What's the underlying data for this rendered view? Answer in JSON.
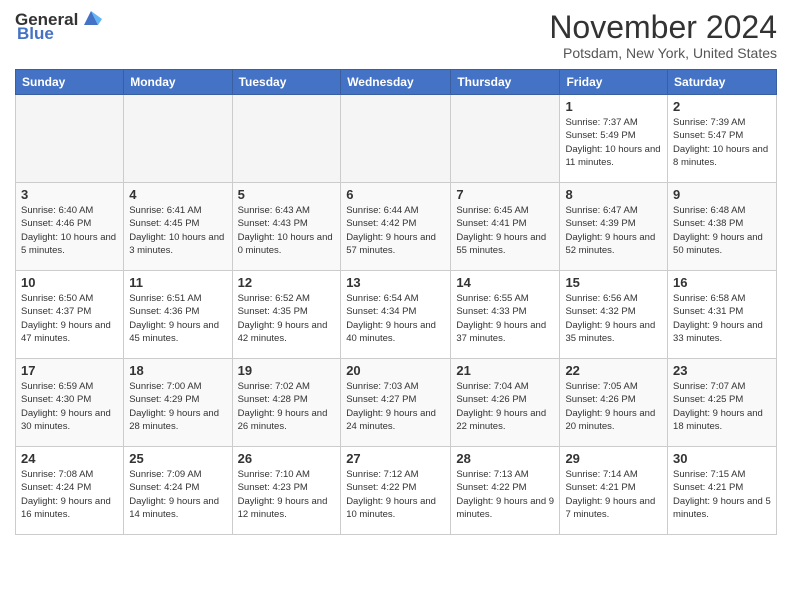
{
  "header": {
    "logo_general": "General",
    "logo_blue": "Blue",
    "month_title": "November 2024",
    "location": "Potsdam, New York, United States"
  },
  "days_of_week": [
    "Sunday",
    "Monday",
    "Tuesday",
    "Wednesday",
    "Thursday",
    "Friday",
    "Saturday"
  ],
  "weeks": [
    [
      {
        "day": "",
        "info": ""
      },
      {
        "day": "",
        "info": ""
      },
      {
        "day": "",
        "info": ""
      },
      {
        "day": "",
        "info": ""
      },
      {
        "day": "",
        "info": ""
      },
      {
        "day": "1",
        "info": "Sunrise: 7:37 AM\nSunset: 5:49 PM\nDaylight: 10 hours and 11 minutes."
      },
      {
        "day": "2",
        "info": "Sunrise: 7:39 AM\nSunset: 5:47 PM\nDaylight: 10 hours and 8 minutes."
      }
    ],
    [
      {
        "day": "3",
        "info": "Sunrise: 6:40 AM\nSunset: 4:46 PM\nDaylight: 10 hours and 5 minutes."
      },
      {
        "day": "4",
        "info": "Sunrise: 6:41 AM\nSunset: 4:45 PM\nDaylight: 10 hours and 3 minutes."
      },
      {
        "day": "5",
        "info": "Sunrise: 6:43 AM\nSunset: 4:43 PM\nDaylight: 10 hours and 0 minutes."
      },
      {
        "day": "6",
        "info": "Sunrise: 6:44 AM\nSunset: 4:42 PM\nDaylight: 9 hours and 57 minutes."
      },
      {
        "day": "7",
        "info": "Sunrise: 6:45 AM\nSunset: 4:41 PM\nDaylight: 9 hours and 55 minutes."
      },
      {
        "day": "8",
        "info": "Sunrise: 6:47 AM\nSunset: 4:39 PM\nDaylight: 9 hours and 52 minutes."
      },
      {
        "day": "9",
        "info": "Sunrise: 6:48 AM\nSunset: 4:38 PM\nDaylight: 9 hours and 50 minutes."
      }
    ],
    [
      {
        "day": "10",
        "info": "Sunrise: 6:50 AM\nSunset: 4:37 PM\nDaylight: 9 hours and 47 minutes."
      },
      {
        "day": "11",
        "info": "Sunrise: 6:51 AM\nSunset: 4:36 PM\nDaylight: 9 hours and 45 minutes."
      },
      {
        "day": "12",
        "info": "Sunrise: 6:52 AM\nSunset: 4:35 PM\nDaylight: 9 hours and 42 minutes."
      },
      {
        "day": "13",
        "info": "Sunrise: 6:54 AM\nSunset: 4:34 PM\nDaylight: 9 hours and 40 minutes."
      },
      {
        "day": "14",
        "info": "Sunrise: 6:55 AM\nSunset: 4:33 PM\nDaylight: 9 hours and 37 minutes."
      },
      {
        "day": "15",
        "info": "Sunrise: 6:56 AM\nSunset: 4:32 PM\nDaylight: 9 hours and 35 minutes."
      },
      {
        "day": "16",
        "info": "Sunrise: 6:58 AM\nSunset: 4:31 PM\nDaylight: 9 hours and 33 minutes."
      }
    ],
    [
      {
        "day": "17",
        "info": "Sunrise: 6:59 AM\nSunset: 4:30 PM\nDaylight: 9 hours and 30 minutes."
      },
      {
        "day": "18",
        "info": "Sunrise: 7:00 AM\nSunset: 4:29 PM\nDaylight: 9 hours and 28 minutes."
      },
      {
        "day": "19",
        "info": "Sunrise: 7:02 AM\nSunset: 4:28 PM\nDaylight: 9 hours and 26 minutes."
      },
      {
        "day": "20",
        "info": "Sunrise: 7:03 AM\nSunset: 4:27 PM\nDaylight: 9 hours and 24 minutes."
      },
      {
        "day": "21",
        "info": "Sunrise: 7:04 AM\nSunset: 4:26 PM\nDaylight: 9 hours and 22 minutes."
      },
      {
        "day": "22",
        "info": "Sunrise: 7:05 AM\nSunset: 4:26 PM\nDaylight: 9 hours and 20 minutes."
      },
      {
        "day": "23",
        "info": "Sunrise: 7:07 AM\nSunset: 4:25 PM\nDaylight: 9 hours and 18 minutes."
      }
    ],
    [
      {
        "day": "24",
        "info": "Sunrise: 7:08 AM\nSunset: 4:24 PM\nDaylight: 9 hours and 16 minutes."
      },
      {
        "day": "25",
        "info": "Sunrise: 7:09 AM\nSunset: 4:24 PM\nDaylight: 9 hours and 14 minutes."
      },
      {
        "day": "26",
        "info": "Sunrise: 7:10 AM\nSunset: 4:23 PM\nDaylight: 9 hours and 12 minutes."
      },
      {
        "day": "27",
        "info": "Sunrise: 7:12 AM\nSunset: 4:22 PM\nDaylight: 9 hours and 10 minutes."
      },
      {
        "day": "28",
        "info": "Sunrise: 7:13 AM\nSunset: 4:22 PM\nDaylight: 9 hours and 9 minutes."
      },
      {
        "day": "29",
        "info": "Sunrise: 7:14 AM\nSunset: 4:21 PM\nDaylight: 9 hours and 7 minutes."
      },
      {
        "day": "30",
        "info": "Sunrise: 7:15 AM\nSunset: 4:21 PM\nDaylight: 9 hours and 5 minutes."
      }
    ]
  ]
}
